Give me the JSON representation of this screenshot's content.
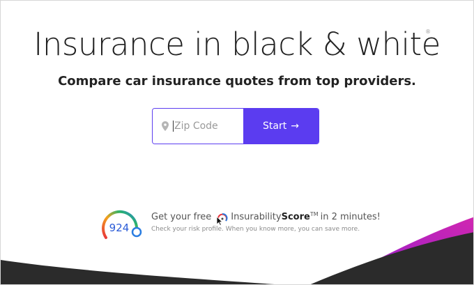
{
  "hero": {
    "title": "Insurance in black & white",
    "registered_mark": "®",
    "subtitle": "Compare car insurance quotes from top providers."
  },
  "zip_form": {
    "placeholder": "Zip Code",
    "value": "",
    "pin_icon": "location-pin-icon",
    "start_label": "Start",
    "arrow": "→"
  },
  "score_badge": {
    "value": "924"
  },
  "promo": {
    "lead": "Get your free",
    "brand_part1": "Insurability",
    "brand_part2": "Score",
    "trademark": "TM",
    "tail": "in 2 minutes!",
    "subtext": "Check your risk profile. When you know more, you can save more."
  },
  "colors": {
    "accent": "#5b3cf0",
    "wave_dark": "#2b2b2b",
    "wave_magenta": "#c021b8"
  }
}
